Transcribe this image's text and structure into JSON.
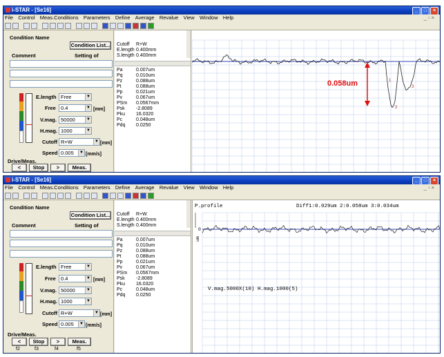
{
  "app": {
    "title": "i-STAR - [Se16]",
    "menu": [
      "File",
      "Control",
      "Meas.Conditions",
      "Parameters",
      "Define",
      "Average",
      "Revalue",
      "View",
      "Window",
      "Help"
    ],
    "mdi_buttons": "_ ▫ ×",
    "win_min": "_",
    "win_max": "□",
    "win_close": "×"
  },
  "condition": {
    "name_label": "Condition Name",
    "list_button": "Condition List...",
    "comment_label": "Comment",
    "average_label": "Setting of average",
    "elength_label": "E.length",
    "elength_value": "Free",
    "free_label": "Free",
    "free_value": "0.4",
    "free_unit": "[mm]",
    "vmag_label": "V.mag.",
    "vmag_value": "50000",
    "hmag_label": "H.mag.",
    "hmag_value": "1000",
    "cutoff_label": "Cutoff",
    "cutoff_value": "R+W",
    "cutoff_unit": "[mm]",
    "speed_label": "Speed",
    "speed_value": "0.005",
    "speed_unit": "[mm/s]",
    "drive_label": "Drive/Meas.",
    "btn_back": "<",
    "btn_stop": "Stop",
    "btn_fwd": ">",
    "btn_meas": "Meas.",
    "f2": "f2",
    "f3": "f3",
    "f4": "f4",
    "f5": "f5",
    "colors": [
      "#cc2222",
      "#e8a020",
      "#2a8a2a",
      "#2255cc",
      "#ffffff"
    ]
  },
  "settings": {
    "cutoff": {
      "k": "Cutoff",
      "v": "R+W"
    },
    "elength": {
      "k": "E.length",
      "v": "0.400mm"
    },
    "slength": {
      "k": "S.length",
      "v": "0.400mm"
    }
  },
  "params": [
    {
      "k": "Pa",
      "v": "0.007um"
    },
    {
      "k": "Pq",
      "v": "0.010um"
    },
    {
      "k": "Pz",
      "v": "0.088um"
    },
    {
      "k": "Pt",
      "v": "0.088um"
    },
    {
      "k": "Pp",
      "v": "0.021um"
    },
    {
      "k": "Pv",
      "v": "0.067um"
    },
    {
      "k": "PSm",
      "v": "0.0567mm"
    },
    {
      "k": "Psk",
      "v": "-2.8089"
    },
    {
      "k": "Pku",
      "v": "16.0320"
    },
    {
      "k": "Pc",
      "v": "0.048um"
    },
    {
      "k": "Pdq",
      "v": "0.0250"
    }
  ],
  "graph1": {
    "annotation": "0.058um",
    "annotation_color": "#e01010",
    "marker_labels": [
      "1",
      "2",
      "3"
    ]
  },
  "graph2": {
    "title": "P.profile",
    "diff": "Diff1:0.029um  2:0.058um  3:0.034um",
    "footer": "V.mag.5000X(10) H.mag.1000(5)",
    "yunit": "um",
    "ytick": "0"
  }
}
